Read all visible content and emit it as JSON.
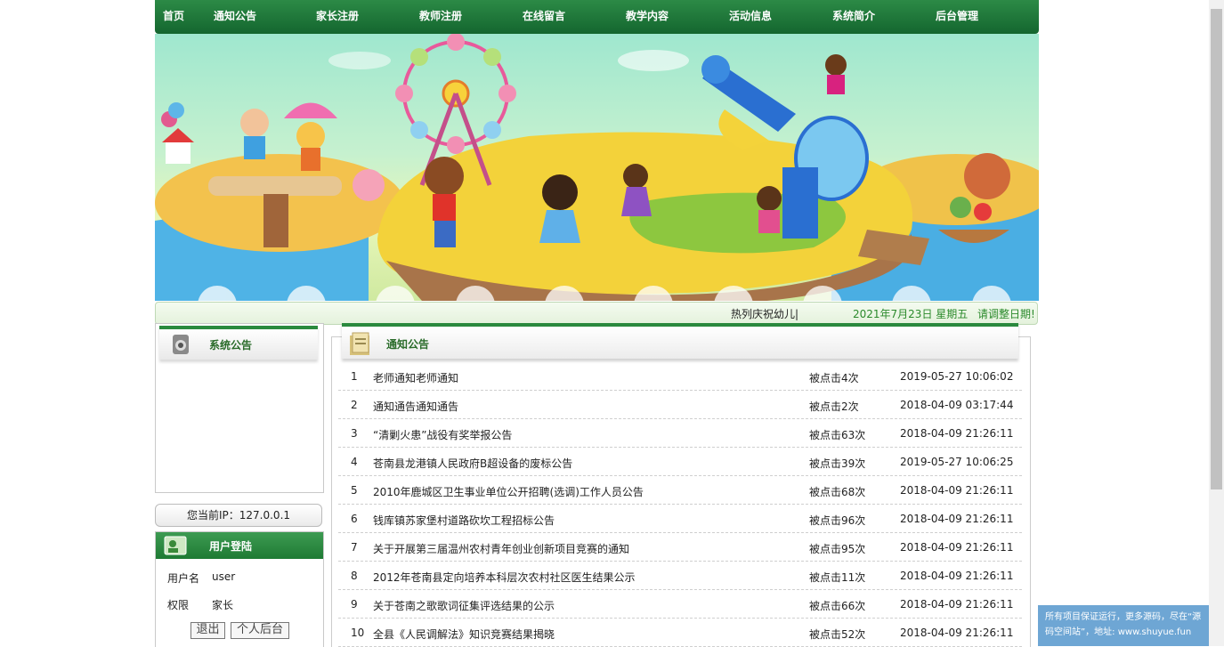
{
  "nav": {
    "items": [
      "首页",
      "通知公告",
      "家长注册",
      "教师注册",
      "在线留言",
      "教学内容",
      "活动信息",
      "系统简介",
      "后台管理"
    ]
  },
  "marquee": {
    "scroll_text": "热列庆祝幼儿|",
    "date": "2021年7月23日 星期五",
    "adjust_link": "请调整日期!"
  },
  "sys_notice": {
    "title": "系统公告"
  },
  "ip": {
    "text": "您当前IP：127.0.0.1"
  },
  "login": {
    "title": "用户登陆",
    "username_label": "用户名",
    "username": "user",
    "role_label": "权限",
    "role": "家长",
    "logout": "退出",
    "personal": "个人后台"
  },
  "notices": {
    "title": "通知公告",
    "rows": [
      {
        "num": "1",
        "title": "老师通知老师通知",
        "clicks": "被点击4次",
        "date": "2019-05-27 10:06:02"
      },
      {
        "num": "2",
        "title": "通知通告通知通告",
        "clicks": "被点击2次",
        "date": "2018-04-09 03:17:44"
      },
      {
        "num": "3",
        "title": "“清剿火患”战役有奖举报公告",
        "clicks": "被点击63次",
        "date": "2018-04-09 21:26:11"
      },
      {
        "num": "4",
        "title": "苍南县龙港镇人民政府B超设备的废标公告",
        "clicks": "被点击39次",
        "date": "2019-05-27 10:06:25"
      },
      {
        "num": "5",
        "title": "2010年鹿城区卫生事业单位公开招聘(选调)工作人员公告",
        "clicks": "被点击68次",
        "date": "2018-04-09 21:26:11"
      },
      {
        "num": "6",
        "title": "钱库镇苏家堡村道路砍坎工程招标公告",
        "clicks": "被点击96次",
        "date": "2018-04-09 21:26:11"
      },
      {
        "num": "7",
        "title": "关于开展第三届温州农村青年创业创新项目竞赛的通知",
        "clicks": "被点击95次",
        "date": "2018-04-09 21:26:11"
      },
      {
        "num": "8",
        "title": "2012年苍南县定向培养本科层次农村社区医生结果公示",
        "clicks": "被点击11次",
        "date": "2018-04-09 21:26:11"
      },
      {
        "num": "9",
        "title": "关于苍南之歌歌词征集评选结果的公示",
        "clicks": "被点击66次",
        "date": "2018-04-09 21:26:11"
      },
      {
        "num": "10",
        "title": "全县《人民调解法》知识竞赛结果揭晓",
        "clicks": "被点击52次",
        "date": "2018-04-09 21:26:11"
      }
    ]
  },
  "ad": {
    "text": "所有项目保证运行，更多源码，尽在“源码空间站”，地址: www.shuyue.fun"
  },
  "colors": {
    "nav_green": "#1e7a34",
    "accent_green": "#2b8a2b",
    "ad_blue": "#6ea6d4"
  }
}
